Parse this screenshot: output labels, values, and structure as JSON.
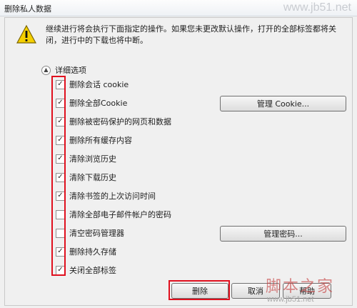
{
  "window": {
    "title": "删除私人数据",
    "watermark_top": "www.jb51.net"
  },
  "warning": {
    "icon": "warning-icon",
    "message": "继续进行将会执行下面指定的操作。如果您未更改默认操作，打开的全部标签都将关闭，进行中的下载也将中断。"
  },
  "details": {
    "toggle_label": "详细选项",
    "options": [
      {
        "label": "删除会话 cookie",
        "checked": true
      },
      {
        "label": "删除全部Cookie",
        "checked": true
      },
      {
        "label": "删除被密码保护的网页和数据",
        "checked": true
      },
      {
        "label": "删除所有缓存内容",
        "checked": true
      },
      {
        "label": "清除浏览历史",
        "checked": true
      },
      {
        "label": "清除下载历史",
        "checked": true
      },
      {
        "label": "清除书签的上次访问时间",
        "checked": true
      },
      {
        "label": "清除全部电子邮件帐户的密码",
        "checked": false
      },
      {
        "label": "清空密码管理器",
        "checked": false
      },
      {
        "label": "删除持久存储",
        "checked": true
      },
      {
        "label": "关闭全部标签",
        "checked": true
      }
    ],
    "manage_cookie_label": "管理 Cookie...",
    "manage_password_label": "管理密码..."
  },
  "footer": {
    "delete_label": "删除",
    "cancel_label": "取消",
    "help_label": "帮助"
  },
  "watermark_bottom": {
    "cn": "脚本之家",
    "url": "www.jb51.net"
  },
  "colors": {
    "highlight": "#e0101e"
  }
}
